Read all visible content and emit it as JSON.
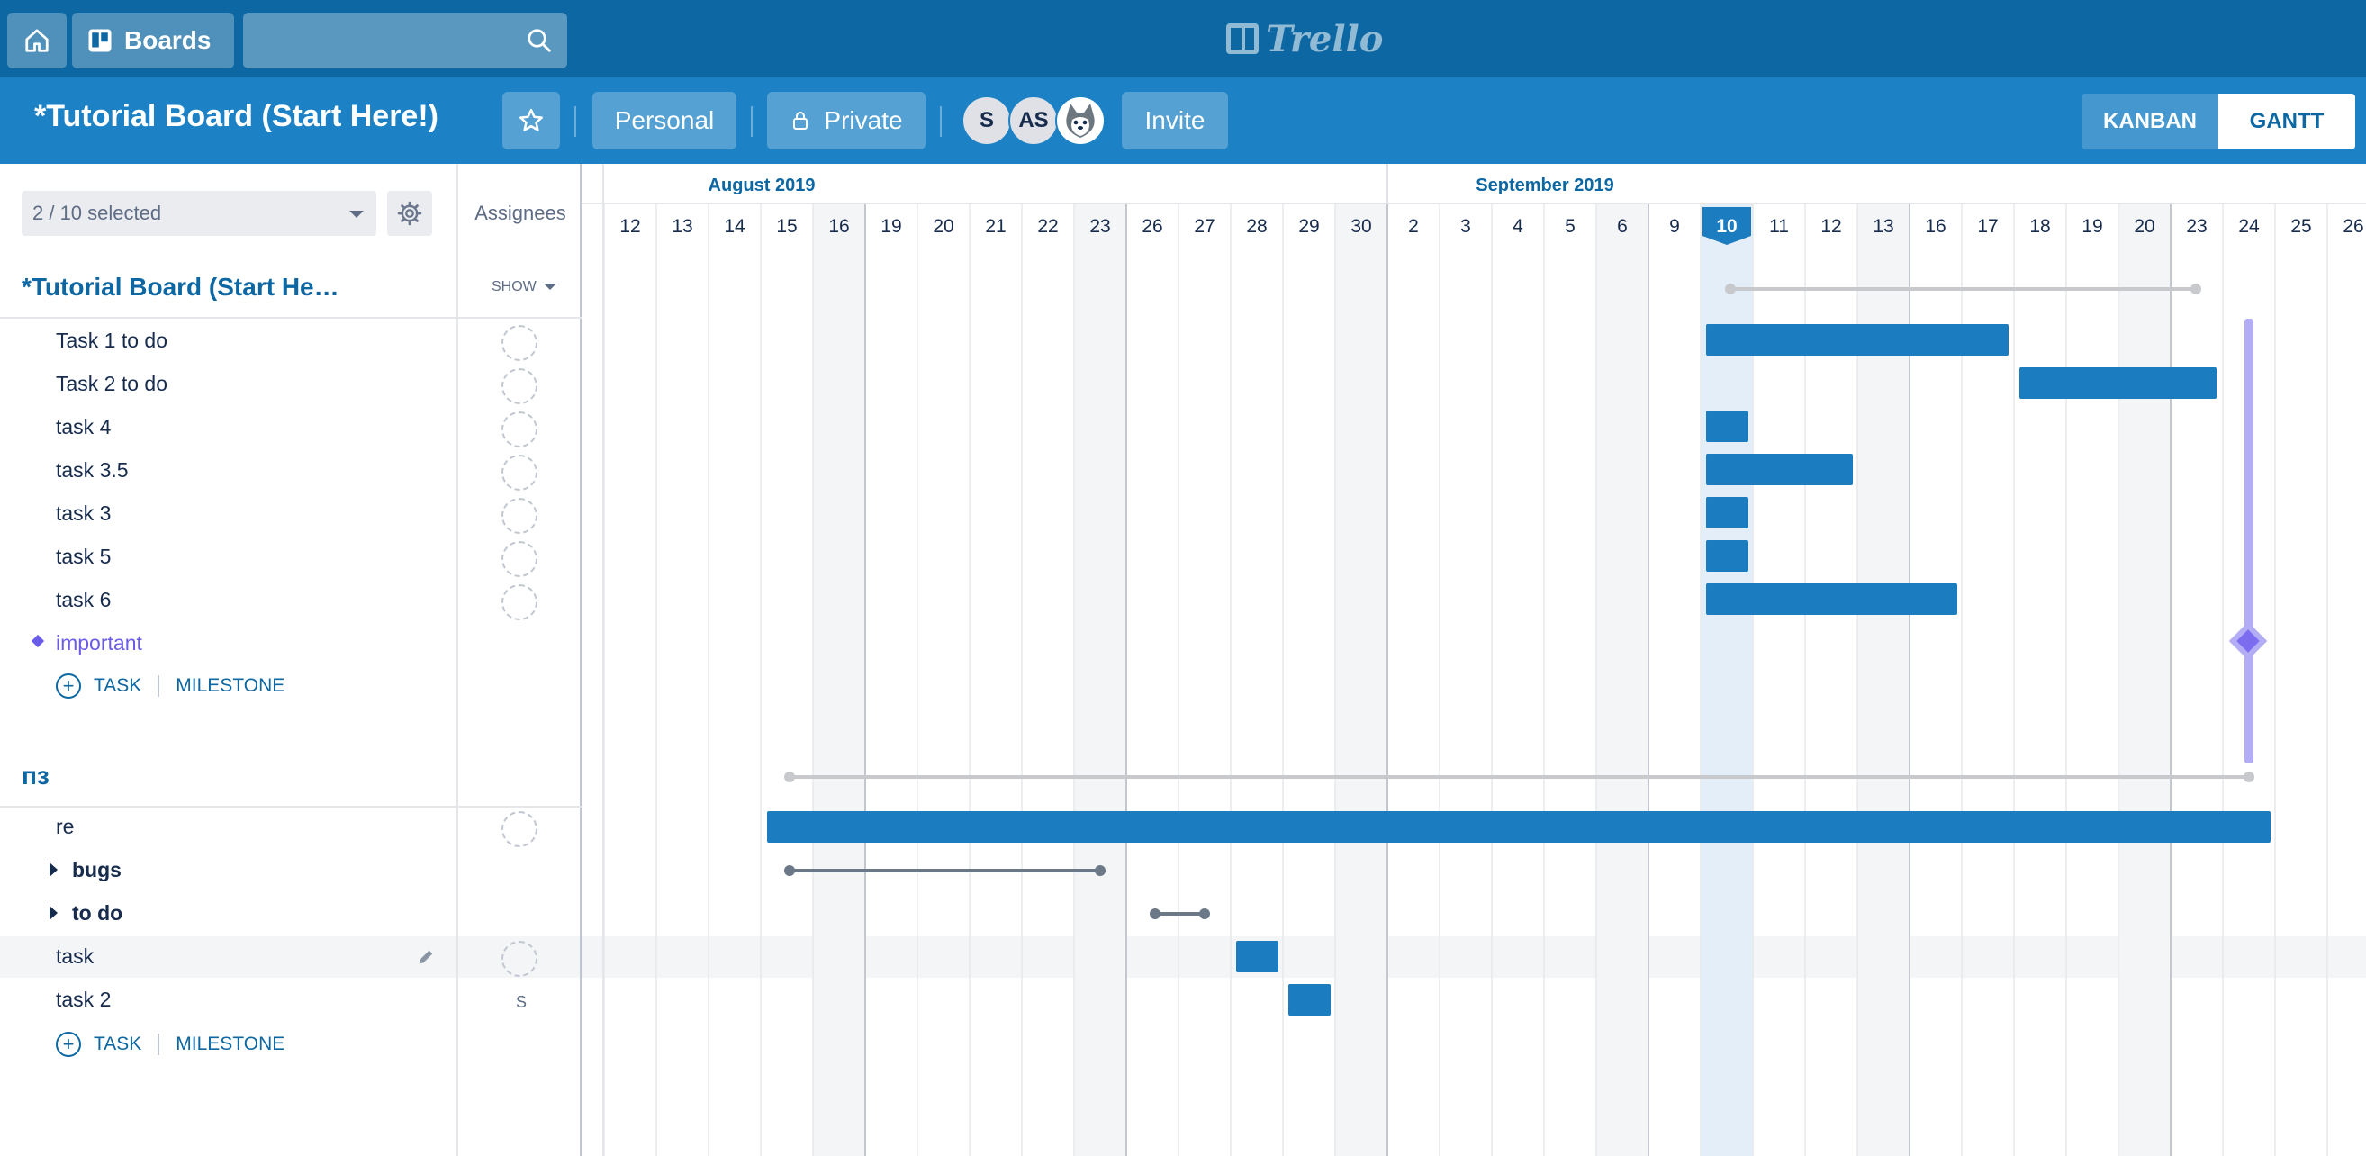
{
  "topbar": {
    "home_icon": "home-icon",
    "boards_label": "Boards",
    "search_placeholder": "",
    "logo_text": "Trello"
  },
  "board": {
    "title": "*Tutorial Board (Start Here!)",
    "personal_label": "Personal",
    "private_label": "Private",
    "invite_label": "Invite",
    "members": [
      "S",
      "AS"
    ],
    "views": {
      "kanban": "KANBAN",
      "gantt": "GANTT"
    }
  },
  "left": {
    "selected": "2 / 10 selected",
    "assignees_header": "Assignees",
    "show_label": "SHOW",
    "group1": {
      "title": "*Tutorial Board (Start He…",
      "tasks": [
        "Task 1 to do",
        "Task 2 to do",
        "task 4",
        "task 3.5",
        "task 3",
        "task 5",
        "task 6"
      ],
      "milestone": "important",
      "add_task": "TASK",
      "add_milestone": "MILESTONE"
    },
    "group2": {
      "title": "пз",
      "task_re": "re",
      "folders": [
        "bugs",
        "to do"
      ],
      "tasks": [
        "task",
        "task 2"
      ],
      "task2_assignee": "S",
      "add_task": "TASK",
      "add_milestone": "MILESTONE"
    }
  },
  "timeline": {
    "months": [
      {
        "label": "August 2019",
        "start": 0
      },
      {
        "label": "September 2019",
        "start": 15
      }
    ],
    "days": [
      "12",
      "13",
      "14",
      "15",
      "16",
      "19",
      "20",
      "21",
      "22",
      "23",
      "26",
      "27",
      "28",
      "29",
      "30",
      "2",
      "3",
      "4",
      "5",
      "6",
      "9",
      "10",
      "11",
      "12",
      "13",
      "16",
      "17",
      "18",
      "19",
      "20",
      "23",
      "24",
      "25",
      "26"
    ],
    "today_index": 21,
    "weekend_shade_indices": [
      4,
      9,
      14,
      19,
      24,
      29
    ],
    "colors": {
      "bar": "#1c7cc0",
      "milestone": "#7b6cf0",
      "today": "#e4eef8",
      "summary": "#c7c9cc",
      "folder_line": "#6b7888"
    }
  }
}
